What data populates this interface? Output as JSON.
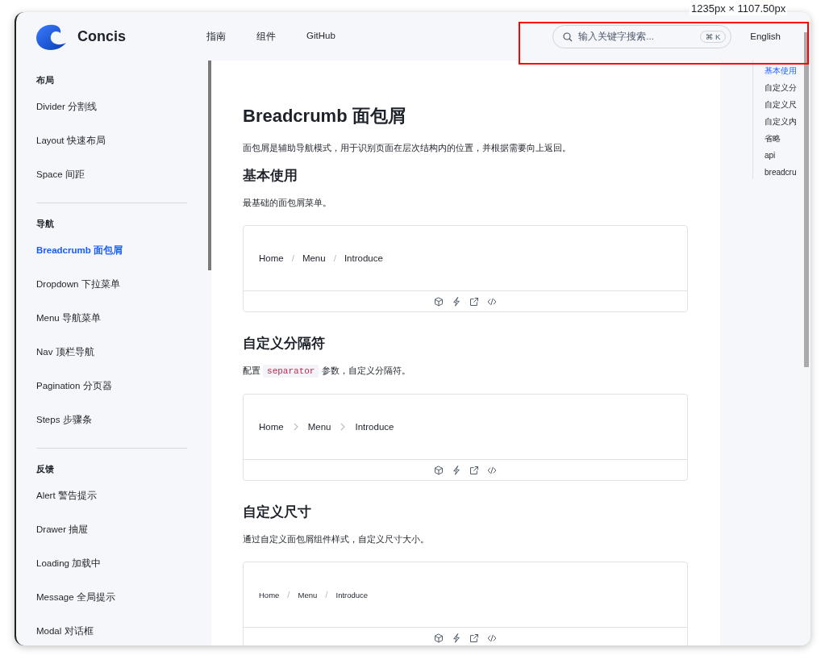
{
  "brand": {
    "name": "Concis"
  },
  "nav": [
    {
      "label": "指南"
    },
    {
      "label": "组件"
    },
    {
      "label": "GitHub"
    }
  ],
  "search": {
    "placeholder": "输入关键字搜索...",
    "shortcut": "⌘ K"
  },
  "language": "English",
  "overlay": {
    "dimensions": "1235px × 1107.50px"
  },
  "sidebar": {
    "groups": [
      {
        "title": "布局",
        "items": [
          {
            "label": "Divider 分割线",
            "selected": false
          },
          {
            "label": "Layout 快速布局",
            "selected": false
          },
          {
            "label": "Space 间距",
            "selected": false
          }
        ]
      },
      {
        "title": "导航",
        "items": [
          {
            "label": "Breadcrumb 面包屑",
            "selected": true
          },
          {
            "label": "Dropdown 下拉菜单",
            "selected": false
          },
          {
            "label": "Menu 导航菜单",
            "selected": false
          },
          {
            "label": "Nav 顶栏导航",
            "selected": false
          },
          {
            "label": "Pagination 分页器",
            "selected": false
          },
          {
            "label": "Steps 步骤条",
            "selected": false
          }
        ]
      },
      {
        "title": "反馈",
        "items": [
          {
            "label": "Alert 警告提示",
            "selected": false
          },
          {
            "label": "Drawer 抽屉",
            "selected": false
          },
          {
            "label": "Loading 加载中",
            "selected": false
          },
          {
            "label": "Message 全局提示",
            "selected": false
          },
          {
            "label": "Modal 对话框",
            "selected": false
          }
        ]
      }
    ]
  },
  "page": {
    "title": "Breadcrumb 面包屑",
    "description": "面包屑是辅助导航模式，用于识别页面在层次结构内的位置，并根据需要向上返回。",
    "sections": [
      {
        "title": "基本使用",
        "description": [
          {
            "kind": "text",
            "text": "最基础的面包屑菜单。"
          }
        ],
        "demo": {
          "small": false,
          "separator": {
            "kind": "text",
            "text": "/"
          },
          "items": [
            "Home",
            "Menu",
            "Introduce"
          ]
        }
      },
      {
        "title": "自定义分隔符",
        "description": [
          {
            "kind": "text",
            "text": "配置 "
          },
          {
            "kind": "code",
            "text": "separator"
          },
          {
            "kind": "text",
            "text": " 参数，自定义分隔符。"
          }
        ],
        "demo": {
          "small": false,
          "separator": {
            "kind": "chevron"
          },
          "items": [
            "Home",
            "Menu",
            "Introduce"
          ]
        }
      },
      {
        "title": "自定义尺寸",
        "description": [
          {
            "kind": "text",
            "text": "通过自定义面包屑组件样式，自定义尺寸大小。"
          }
        ],
        "demo": {
          "small": true,
          "separator": {
            "kind": "text",
            "text": "/"
          },
          "items": [
            "Home",
            "Menu",
            "Introduce"
          ]
        }
      }
    ]
  },
  "toc": [
    {
      "label": "基本使用",
      "selected": true
    },
    {
      "label": "自定义分",
      "selected": false
    },
    {
      "label": "自定义尺",
      "selected": false
    },
    {
      "label": "自定义内",
      "selected": false
    },
    {
      "label": "省略",
      "selected": false
    },
    {
      "label": "api",
      "selected": false
    },
    {
      "label": "breadcru",
      "selected": false
    }
  ]
}
